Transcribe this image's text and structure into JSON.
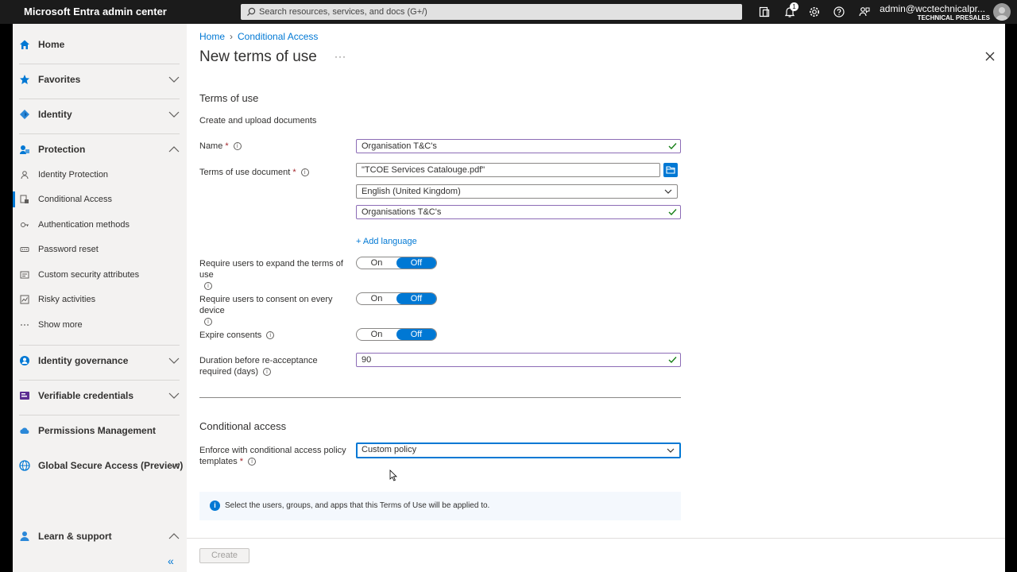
{
  "app": {
    "title": "Microsoft Entra admin center",
    "search_placeholder": "Search resources, services, and docs (G+/)",
    "notification_count": "1",
    "user_name": "admin@wcctechnicalpr...",
    "user_org": "TECHNICAL PRESALES",
    "toolbar_icons": [
      "portal-icon",
      "bell-icon",
      "gear-icon",
      "help-icon",
      "feedback-icon"
    ]
  },
  "sidebar": {
    "home": "Home",
    "favorites": "Favorites",
    "identity": "Identity",
    "protection": "Protection",
    "protection_items": [
      "Identity Protection",
      "Conditional Access",
      "Authentication methods",
      "Password reset",
      "Custom security attributes",
      "Risky activities",
      "Show more"
    ],
    "identity_governance": "Identity governance",
    "verifiable_credentials": "Verifiable credentials",
    "permissions_management": "Permissions Management",
    "global_secure_access": "Global Secure Access (Preview)",
    "learn_support": "Learn & support",
    "collapse": "«"
  },
  "breadcrumb": {
    "home": "Home",
    "current": "Conditional Access"
  },
  "page": {
    "title": "New terms of use",
    "more": "···"
  },
  "terms": {
    "section_title": "Terms of use",
    "subtitle": "Create and upload documents",
    "name_label": "Name",
    "name_value": "Organisation T&C's",
    "doc_label": "Terms of use document",
    "doc_value": "\"TCOE Services Catalouge.pdf\"",
    "language_value": "English (United Kingdom)",
    "display_name_value": "Organisations T&C's",
    "add_language": "+ Add language",
    "expand_label": "Require users to expand the terms of use",
    "consent_label": "Require users to consent on every device",
    "expire_label": "Expire consents",
    "toggle_on": "On",
    "toggle_off": "Off",
    "duration_label": "Duration before re-acceptance required (days)",
    "duration_value": "90"
  },
  "conditional": {
    "section_title": "Conditional access",
    "enforce_label": "Enforce with conditional access policy templates",
    "enforce_value": "Custom policy",
    "info_text": "Select the users, groups, and apps that this Terms of Use will be applied to."
  },
  "footer": {
    "create": "Create"
  },
  "colors": {
    "accent": "#0078d4",
    "topbar": "#1b1b1b",
    "sidebar": "#f3f2f1",
    "valid_check": "#107c10"
  }
}
